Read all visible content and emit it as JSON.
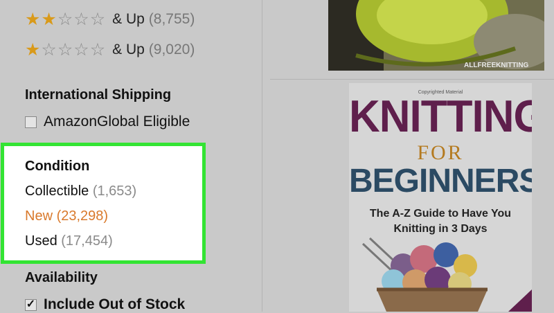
{
  "ratings": [
    {
      "filled": 2,
      "label": "& Up",
      "count": "(8,755)"
    },
    {
      "filled": 1,
      "label": "& Up",
      "count": "(9,020)"
    }
  ],
  "international_shipping": {
    "title": "International Shipping",
    "option_label": "AmazonGlobal Eligible",
    "checked": false
  },
  "condition": {
    "title": "Condition",
    "items": [
      {
        "label": "Collectible",
        "count": "(1,653)",
        "selected": false
      },
      {
        "label": "New",
        "count": "(23,298)",
        "selected": true
      },
      {
        "label": "Used",
        "count": "(17,454)",
        "selected": false
      }
    ]
  },
  "availability": {
    "title": "Availability",
    "option_label": "Include Out of Stock",
    "checked": true
  },
  "product_top": {
    "watermark": "ALLFREEKNITTING"
  },
  "book": {
    "tiny": "Copyrighted Material",
    "line1": "KNITTING",
    "line2": "FOR",
    "line3": "BEGINNERS",
    "subtitle_line1": "The A-Z Guide to Have You",
    "subtitle_line2": "Knitting in 3 Days"
  },
  "colors": {
    "highlight_border": "#33e433",
    "star": "#d99a1a",
    "selected_text": "#d9792b"
  }
}
